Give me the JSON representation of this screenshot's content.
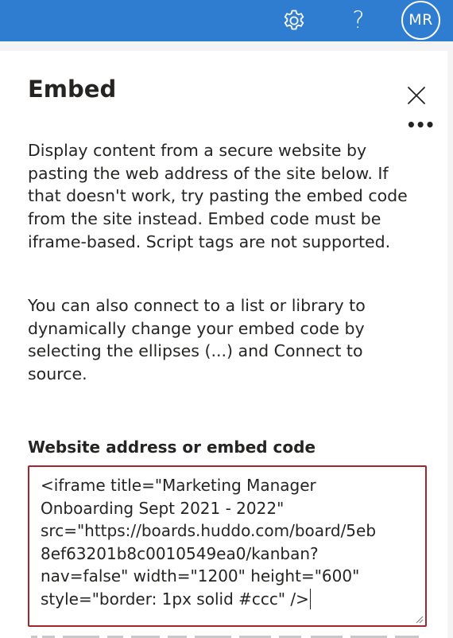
{
  "topbar": {
    "icons": [
      "gear-icon",
      "help-icon"
    ],
    "help_glyph": "?",
    "avatar_initials": "MR",
    "color": "#2f7dd1"
  },
  "panel": {
    "title": "Embed",
    "close_icon": "close-icon",
    "more_icon": "more-icon",
    "more_glyph": "•••",
    "description_1": "Display content from a secure website by pasting the web address of the site below. If that doesn't work, try pasting the embed code from the site instead. Embed code must be iframe-based. Script tags are not supported.",
    "description_2": "You can also connect to a list or library to dynamically change your embed code by selecting the ellipses (...) and Connect to source."
  },
  "field": {
    "label": "Website address or embed code",
    "value": "<iframe title=\"Marketing Manager\nOnboarding Sept 2021 - 2022\"\nsrc=\"https://boards.huddo.com/board/5eb\n8ef63201b8c0010549ea0/kanban?\nnav=false\" width=\"1200\" height=\"600\"\nstyle=\"border: 1px solid #ccc\" />",
    "border_color": "#a4262c"
  }
}
